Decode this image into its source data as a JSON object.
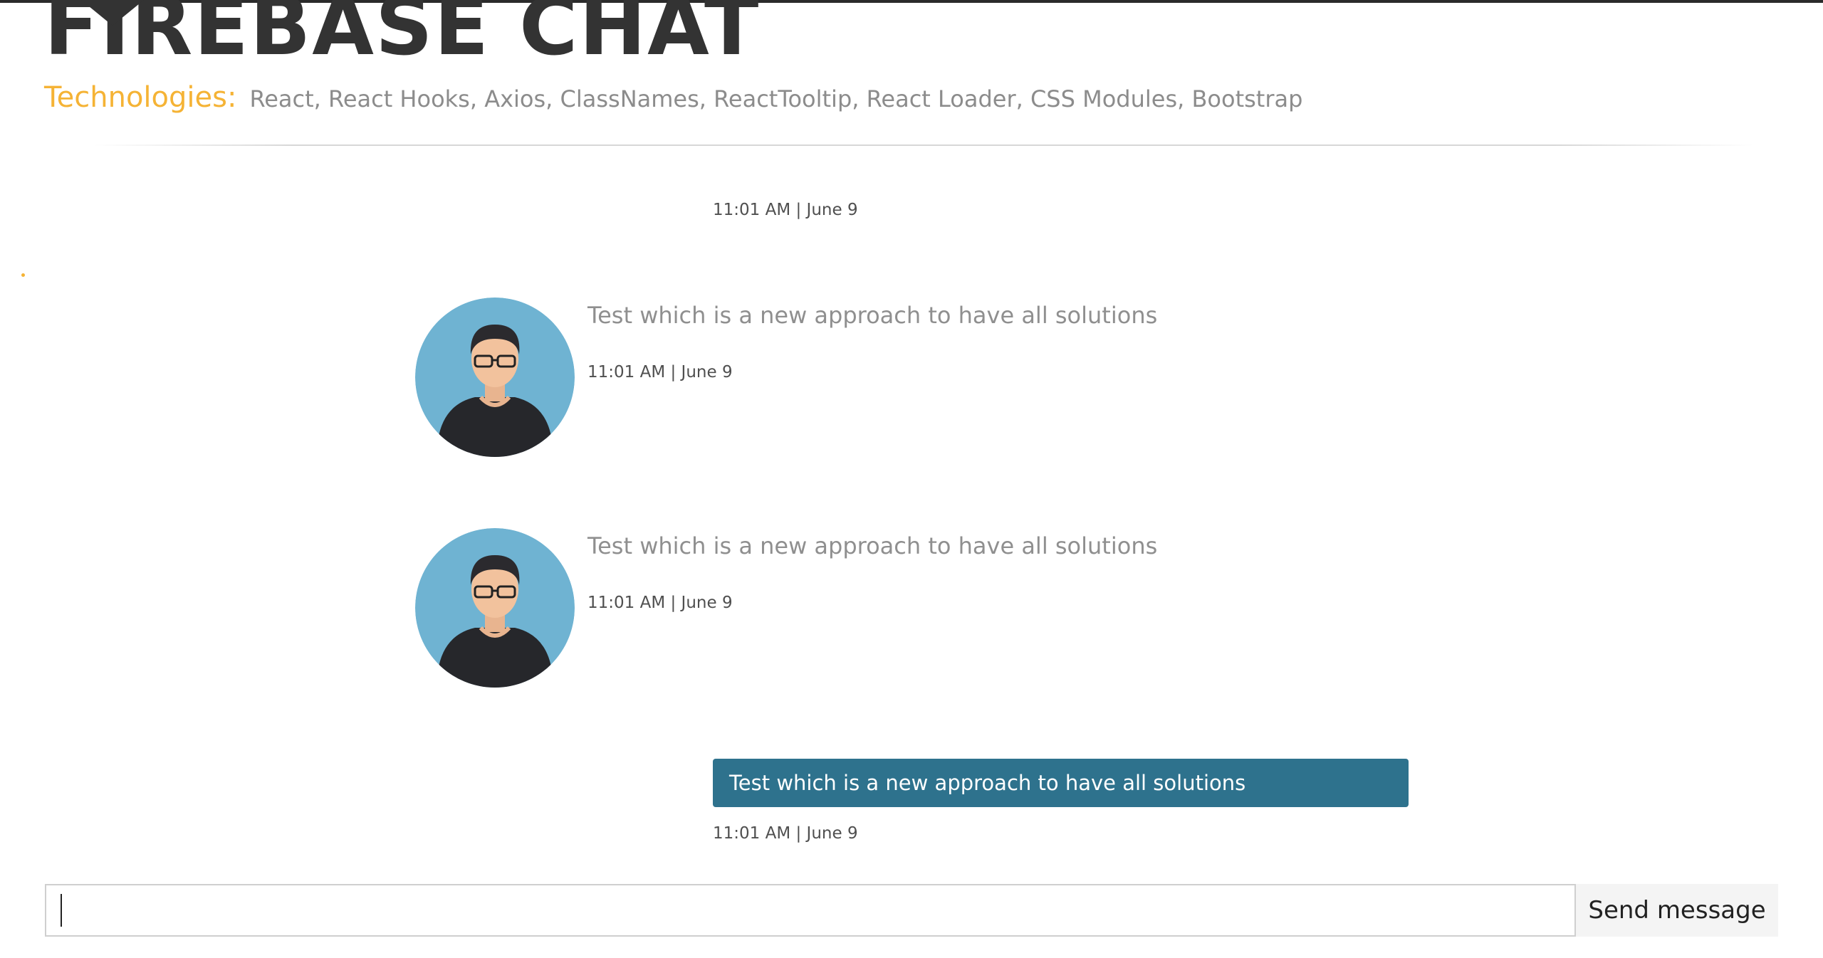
{
  "header": {
    "title": "FIREBASE CHAT",
    "technologies_label": "Technologies:",
    "technologies_list": "React, React Hooks, Axios, ClassNames, ReactTooltip, React Loader, CSS Modules, Bootstrap"
  },
  "messages": [
    {
      "type": "timestamp-only",
      "time": "11:01 AM | June 9"
    },
    {
      "type": "incoming",
      "text": "Test which is a new approach to have all solutions",
      "time": "11:01 AM | June 9",
      "avatar": "user-avatar-icon"
    },
    {
      "type": "incoming",
      "text": "Test which is a new approach to have all solutions",
      "time": "11:01 AM | June 9",
      "avatar": "user-avatar-icon"
    },
    {
      "type": "outgoing",
      "text": "Test which is a new approach to have all solutions",
      "time": "11:01 AM | June 9"
    }
  ],
  "composer": {
    "input_value": "",
    "send_label": "Send message"
  },
  "colors": {
    "accent": "#f5b335",
    "bubble": "#2e728d",
    "avatar_bg": "#6fb3d2"
  }
}
